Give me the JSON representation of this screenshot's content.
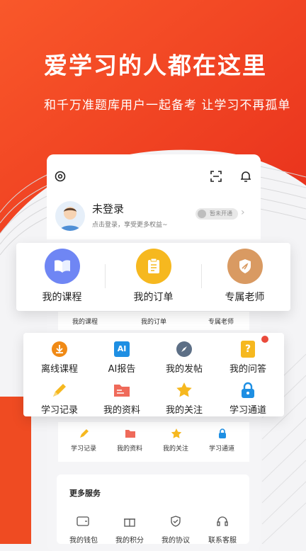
{
  "hero": {
    "headline": "爱学习的人都在这里",
    "subline": "和千万准题库用户一起备考 让学习不再孤单"
  },
  "profile": {
    "name": "未登录",
    "hint": "点击登录，享受更多权益~",
    "vip_badge": "暂未开通"
  },
  "main_actions": [
    {
      "label": "我的课程",
      "icon": "book-icon",
      "color": "#6f86f4"
    },
    {
      "label": "我的订单",
      "icon": "clipboard-icon",
      "color": "#f6b81f"
    },
    {
      "label": "专属老师",
      "icon": "teacher-icon",
      "color": "#d99a62"
    }
  ],
  "main_actions_small": [
    "我的课程",
    "我的订单",
    "专属老师"
  ],
  "grid_items": [
    {
      "label": "离线课程",
      "icon": "download-icon"
    },
    {
      "label": "AI报告",
      "icon": "ai-icon",
      "badge_text": "AI"
    },
    {
      "label": "我的发帖",
      "icon": "compass-icon"
    },
    {
      "label": "我的问答",
      "icon": "question-icon",
      "badge_text": "?"
    },
    {
      "label": "学习记录",
      "icon": "pencil-icon"
    },
    {
      "label": "我的资料",
      "icon": "folder-icon"
    },
    {
      "label": "我的关注",
      "icon": "star-icon"
    },
    {
      "label": "学习通道",
      "icon": "lock-icon"
    }
  ],
  "grid_small": [
    "学习记录",
    "我的资料",
    "我的关注",
    "学习通道"
  ],
  "more": {
    "title": "更多服务",
    "items": [
      "我的钱包",
      "我的积分",
      "我的协议",
      "联系客服"
    ]
  },
  "colors": {
    "brand_red": "#ef4b22",
    "accent_blue": "#1e8fe3",
    "accent_orange": "#f08a16"
  }
}
